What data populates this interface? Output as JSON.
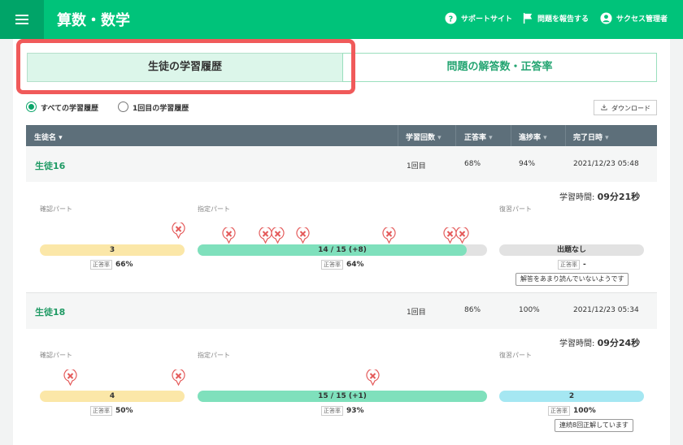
{
  "app": {
    "title": "算数・数学"
  },
  "header": {
    "support": "サポートサイト",
    "report": "問題を報告する",
    "user": "サクセス管理者"
  },
  "tabs": [
    {
      "label": "生徒の学習履歴",
      "active": true
    },
    {
      "label": "問題の解答数・正答率",
      "active": false
    }
  ],
  "filters": [
    {
      "label": "すべての学習履歴",
      "selected": true
    },
    {
      "label": "1回目の学習履歴",
      "selected": false
    }
  ],
  "download": {
    "label": "ダウンロード"
  },
  "table": {
    "columns": [
      "生徒名",
      "学習回数",
      "正答率",
      "進捗率",
      "完了日時"
    ]
  },
  "rate_tag": "正答率",
  "time_label": "学習時間:",
  "sections": {
    "confirm": "確認パート",
    "assigned": "指定パート",
    "review": "復習パート"
  },
  "students": [
    {
      "name": "生徒16",
      "count": "1回目",
      "accuracy": "68%",
      "progress": "94%",
      "completed": "2021/12/23 05:48",
      "time": "09分21秒",
      "confirm": {
        "bar": "3",
        "rate": "66%",
        "fill": 1.0
      },
      "assigned": {
        "bar": "14 / 15 (+8)",
        "rate": "64%",
        "fill": 0.93
      },
      "review": {
        "bar": "出題なし",
        "rate": "-",
        "fill": 1.0,
        "note": "解答をあまり読んでいないようです"
      }
    },
    {
      "name": "生徒18",
      "count": "1回目",
      "accuracy": "86%",
      "progress": "100%",
      "completed": "2021/12/23 05:34",
      "time": "09分24秒",
      "confirm": {
        "bar": "4",
        "rate": "50%",
        "fill": 1.0
      },
      "assigned": {
        "bar": "15 / 15 (+1)",
        "rate": "93%",
        "fill": 1.0
      },
      "review": {
        "bar": "2",
        "rate": "100%",
        "fill": 1.0,
        "note": "連続8回正解しています"
      }
    }
  ],
  "colors": {
    "brand": "#00c37a",
    "confirm_bar": "#fbe7a8",
    "assigned_bar": "#7fe0bc",
    "review_bar_empty": "#e2e2e2",
    "review_bar": "#a5e7f2",
    "wrong_mark": "#e45a5a"
  }
}
